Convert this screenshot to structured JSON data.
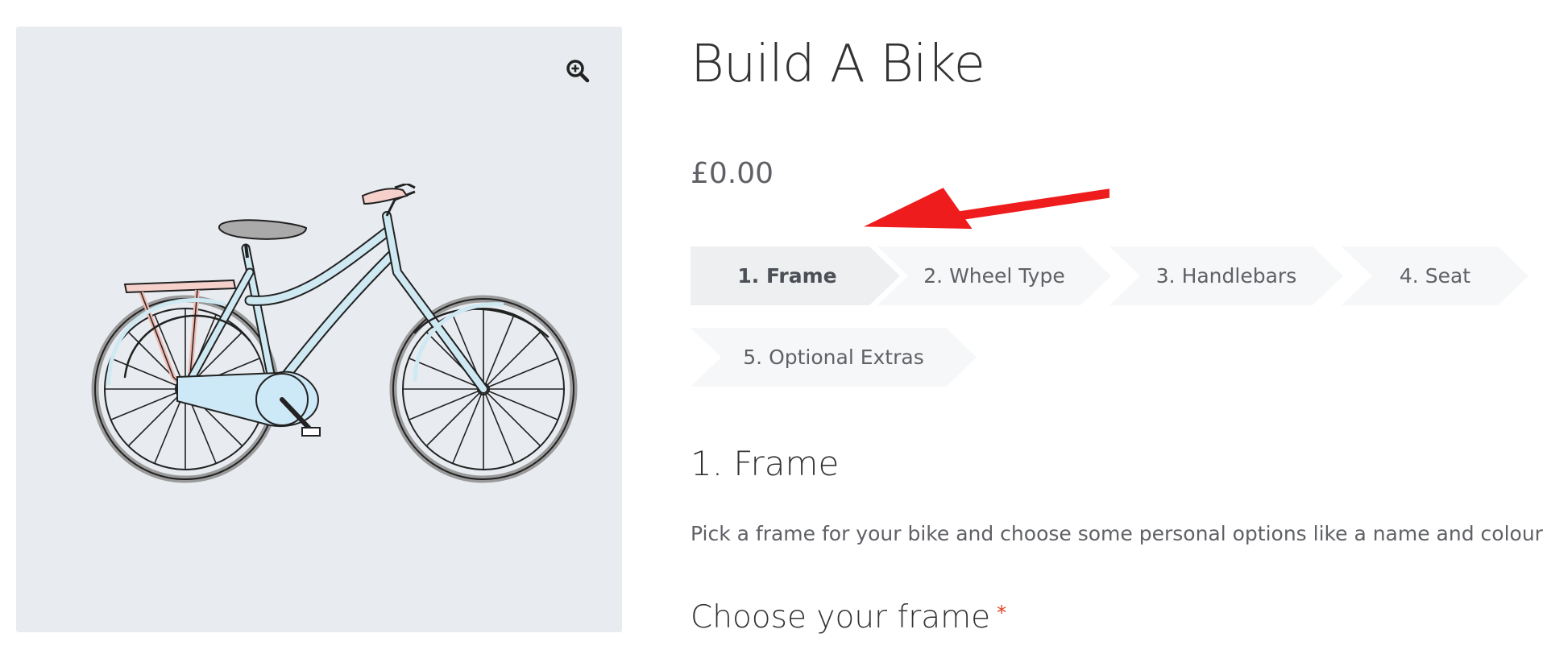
{
  "product": {
    "title": "Build A Bike",
    "price": "£0.00",
    "image_alt": "bicycle illustration",
    "zoom_icon": "zoom-in-icon"
  },
  "steps": [
    {
      "label": "1. Frame",
      "active": true
    },
    {
      "label": "2. Wheel Type",
      "active": false
    },
    {
      "label": "3. Handlebars",
      "active": false
    },
    {
      "label": "4. Seat",
      "active": false
    },
    {
      "label": "5. Optional Extras",
      "active": false
    }
  ],
  "current_step": {
    "title": "1. Frame",
    "description": "Pick a frame for your bike and choose some personal options like a name and colour",
    "field_label": "Choose your frame",
    "required_mark": "*"
  },
  "colors": {
    "gallery_bg": "#e8ecf0",
    "step_active_bg": "#eeeff1",
    "step_inactive_bg": "#f6f7f8",
    "annotation_arrow": "#ee1c1c",
    "required": "#e2401c"
  }
}
